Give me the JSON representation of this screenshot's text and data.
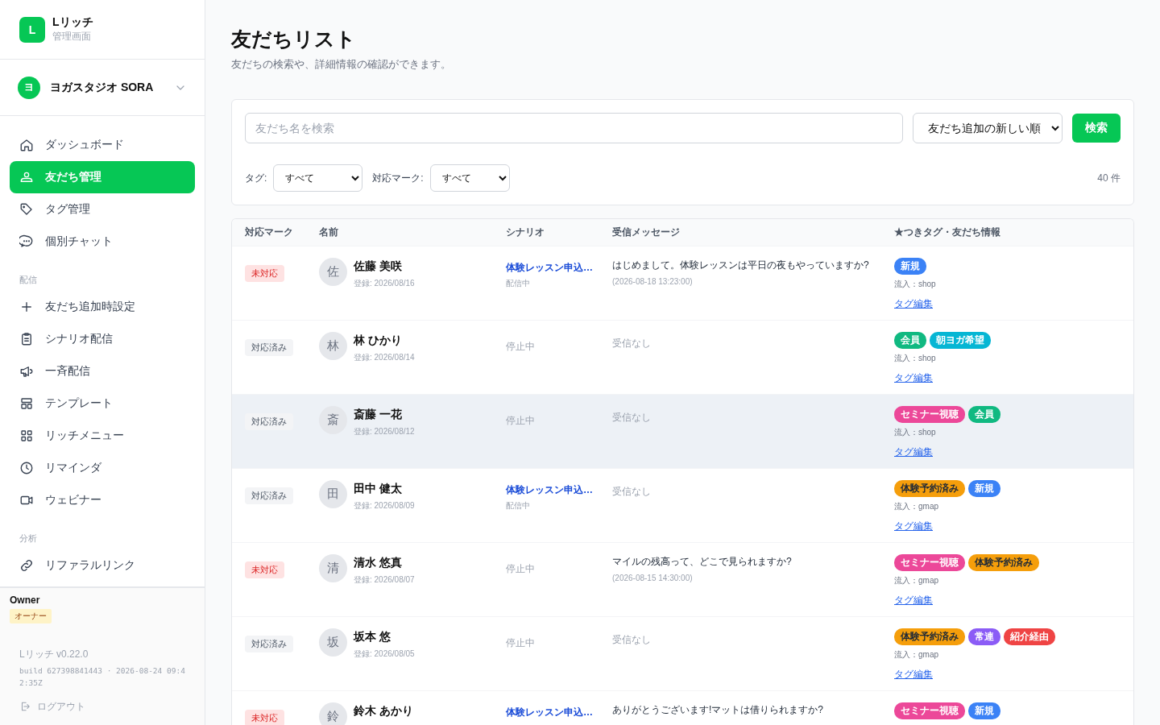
{
  "brand": {
    "logo": "L",
    "name": "Lリッチ",
    "subtitle": "管理画面"
  },
  "workspace": {
    "avatar": "ヨ",
    "name": "ヨガスタジオ SORA"
  },
  "nav": [
    {
      "items": [
        {
          "label": "ダッシュボード",
          "selected": false
        },
        {
          "label": "友だち管理",
          "selected": true
        },
        {
          "label": "タグ管理",
          "selected": false
        },
        {
          "label": "個別チャット",
          "selected": false
        }
      ]
    },
    {
      "heading": "配信",
      "items": [
        {
          "label": "友だち追加時設定",
          "selected": false
        },
        {
          "label": "シナリオ配信",
          "selected": false
        },
        {
          "label": "一斉配信",
          "selected": false
        },
        {
          "label": "テンプレート",
          "selected": false
        },
        {
          "label": "リッチメニュー",
          "selected": false
        },
        {
          "label": "リマインダ",
          "selected": false
        },
        {
          "label": "ウェビナー",
          "selected": false
        }
      ]
    },
    {
      "heading": "分析",
      "items": [
        {
          "label": "リファラルリンク",
          "selected": false
        }
      ]
    }
  ],
  "user": {
    "name": "Owner",
    "role": "オーナー"
  },
  "version": "Lリッチ v0.22.0",
  "build": "build 627398841443 · 2026-08-24 09:42:35Z",
  "logout": "ログアウト",
  "page": {
    "title": "友だちリスト",
    "subtitle": "友だちの検索や、詳細情報の確認ができます。"
  },
  "filters": {
    "search_placeholder": "友だち名を検索",
    "sort": "友だち追加の新しい順",
    "search_button": "検索",
    "tag_label": "タグ:",
    "tag_value": "すべて",
    "mark_label": "対応マーク:",
    "mark_value": "すべて",
    "count": "40 件"
  },
  "table": {
    "columns": [
      "対応マーク",
      "名前",
      "シナリオ",
      "受信メッセージ",
      "★つきタグ・友だち情報"
    ],
    "rows": [
      {
        "mark": {
          "kind": "pending",
          "label": "未対応"
        },
        "avatar": "佐",
        "name": "佐藤 美咲",
        "registered": "登録: 2026/08/16",
        "scenario": {
          "active": true,
          "name": "体験レッスン申込…",
          "status": "配信中"
        },
        "message": {
          "kind": "received",
          "text": "はじめまして。体験レッスンは平日の夜もやっていますか?",
          "time": "(2026-08-18 13:23:00)"
        },
        "tags": [
          {
            "label": "新規",
            "color": "#3b82f6"
          }
        ],
        "source": "流入：shop",
        "edit": "タグ編集",
        "highlighted": false
      },
      {
        "mark": {
          "kind": "done",
          "label": "対応済み"
        },
        "avatar": "林",
        "name": "林 ひかり",
        "registered": "登録: 2026/08/14",
        "scenario": {
          "active": false,
          "status": "停止中"
        },
        "message": {
          "kind": "none",
          "text": "受信なし"
        },
        "tags": [
          {
            "label": "会員",
            "color": "#10b981"
          },
          {
            "label": "朝ヨガ希望",
            "color": "#06b6d4"
          }
        ],
        "source": "流入：shop",
        "edit": "タグ編集",
        "highlighted": false
      },
      {
        "mark": {
          "kind": "done",
          "label": "対応済み"
        },
        "avatar": "斎",
        "name": "斎藤 一花",
        "registered": "登録: 2026/08/12",
        "scenario": {
          "active": false,
          "status": "停止中"
        },
        "message": {
          "kind": "none",
          "text": "受信なし"
        },
        "tags": [
          {
            "label": "セミナー視聴",
            "color": "#ec4899"
          },
          {
            "label": "会員",
            "color": "#10b981"
          }
        ],
        "source": "流入：shop",
        "edit": "タグ編集",
        "highlighted": true
      },
      {
        "mark": {
          "kind": "done",
          "label": "対応済み"
        },
        "avatar": "田",
        "name": "田中 健太",
        "registered": "登録: 2026/08/09",
        "scenario": {
          "active": true,
          "name": "体験レッスン申込…",
          "status": "配信中"
        },
        "message": {
          "kind": "none",
          "text": "受信なし"
        },
        "tags": [
          {
            "label": "体験予約済み",
            "color": "#f59e0b"
          },
          {
            "label": "新規",
            "color": "#3b82f6"
          }
        ],
        "source": "流入：gmap",
        "edit": "タグ編集",
        "highlighted": false
      },
      {
        "mark": {
          "kind": "pending",
          "label": "未対応"
        },
        "avatar": "清",
        "name": "清水 悠真",
        "registered": "登録: 2026/08/07",
        "scenario": {
          "active": false,
          "status": "停止中"
        },
        "message": {
          "kind": "received",
          "text": "マイルの残高って、どこで見られますか?",
          "time": "(2026-08-15 14:30:00)"
        },
        "tags": [
          {
            "label": "セミナー視聴",
            "color": "#ec4899"
          },
          {
            "label": "体験予約済み",
            "color": "#f59e0b"
          }
        ],
        "source": "流入：gmap",
        "edit": "タグ編集",
        "highlighted": false
      },
      {
        "mark": {
          "kind": "done",
          "label": "対応済み"
        },
        "avatar": "坂",
        "name": "坂本 悠",
        "registered": "登録: 2026/08/05",
        "scenario": {
          "active": false,
          "status": "停止中"
        },
        "message": {
          "kind": "none",
          "text": "受信なし"
        },
        "tags": [
          {
            "label": "体験予約済み",
            "color": "#f59e0b"
          },
          {
            "label": "常連",
            "color": "#8b5cf6"
          },
          {
            "label": "紹介経由",
            "color": "#ef4444"
          }
        ],
        "source": "流入：gmap",
        "edit": "タグ編集",
        "highlighted": false
      },
      {
        "mark": {
          "kind": "pending",
          "label": "未対応"
        },
        "avatar": "鈴",
        "name": "鈴木 あかり",
        "scenario": {
          "active": true,
          "name": "体験レッスン申込…"
        },
        "message": {
          "kind": "received",
          "text": "ありがとうございます!マットは借りられますか?"
        },
        "tags": [
          {
            "label": "セミナー視聴",
            "color": "#ec4899"
          },
          {
            "label": "新規",
            "color": "#3b82f6"
          }
        ],
        "highlighted": false
      }
    ]
  }
}
